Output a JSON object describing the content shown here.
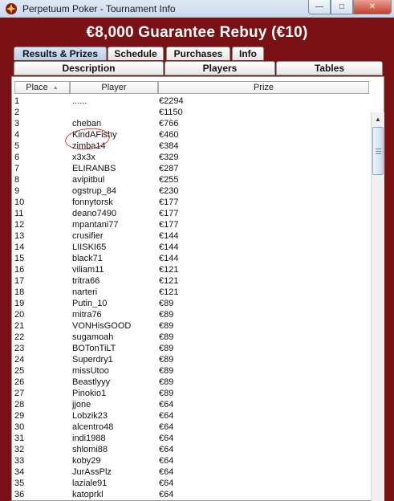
{
  "window": {
    "title": "Perpetuum Poker - Tournament Info",
    "minimize_glyph": "—",
    "maximize_glyph": "□",
    "close_glyph": "✕"
  },
  "heading": "€8,000 Guarantee Rebuy (€10)",
  "tabs_row1": {
    "results": "Results & Prizes",
    "schedule": "Schedule",
    "purchases": "Purchases",
    "info": "Info"
  },
  "tabs_row2": {
    "description": "Description",
    "players": "Players",
    "tables": "Tables"
  },
  "columns": {
    "place": "Place",
    "player": "Player",
    "prize": "Prize"
  },
  "rows": [
    {
      "place": "1",
      "player": "......",
      "prize": "€2294"
    },
    {
      "place": "2",
      "player": "",
      "prize": "€1150"
    },
    {
      "place": "3",
      "player": "cheban",
      "prize": "€766"
    },
    {
      "place": "4",
      "player": "KindAFishy",
      "prize": "€460"
    },
    {
      "place": "5",
      "player": "zimba14",
      "prize": "€384"
    },
    {
      "place": "6",
      "player": "x3x3x",
      "prize": "€329"
    },
    {
      "place": "7",
      "player": "ELIRANBS",
      "prize": "€287"
    },
    {
      "place": "8",
      "player": "avipitbul",
      "prize": "€255"
    },
    {
      "place": "9",
      "player": "ogstrup_84",
      "prize": "€230"
    },
    {
      "place": "10",
      "player": "fonnytorsk",
      "prize": "€177"
    },
    {
      "place": "11",
      "player": "deano7490",
      "prize": "€177"
    },
    {
      "place": "12",
      "player": "mpantani77",
      "prize": "€177"
    },
    {
      "place": "13",
      "player": "crusifier",
      "prize": "€144"
    },
    {
      "place": "14",
      "player": "LIISKI65",
      "prize": "€144"
    },
    {
      "place": "15",
      "player": "black71",
      "prize": "€144"
    },
    {
      "place": "16",
      "player": "viliam11",
      "prize": "€121"
    },
    {
      "place": "17",
      "player": "tritra66",
      "prize": "€121"
    },
    {
      "place": "18",
      "player": "narteri",
      "prize": "€121"
    },
    {
      "place": "19",
      "player": "Putin_10",
      "prize": "€89"
    },
    {
      "place": "20",
      "player": "mitra76",
      "prize": "€89"
    },
    {
      "place": "21",
      "player": "VONHisGOOD",
      "prize": "€89"
    },
    {
      "place": "22",
      "player": "sugamoah",
      "prize": "€89"
    },
    {
      "place": "23",
      "player": "BOTonTiLT",
      "prize": "€89"
    },
    {
      "place": "24",
      "player": "Superdry1",
      "prize": "€89"
    },
    {
      "place": "25",
      "player": "missUtoo",
      "prize": "€89"
    },
    {
      "place": "26",
      "player": "Beastlyyy",
      "prize": "€89"
    },
    {
      "place": "27",
      "player": "Pinokio1",
      "prize": "€89"
    },
    {
      "place": "28",
      "player": "jjone",
      "prize": "€64"
    },
    {
      "place": "29",
      "player": "Lobzik23",
      "prize": "€64"
    },
    {
      "place": "30",
      "player": "alcentro48",
      "prize": "€64"
    },
    {
      "place": "31",
      "player": "indi1988",
      "prize": "€64"
    },
    {
      "place": "32",
      "player": "shlomi88",
      "prize": "€64"
    },
    {
      "place": "33",
      "player": "koby29",
      "prize": "€64"
    },
    {
      "place": "34",
      "player": "JurAssPlz",
      "prize": "€64"
    },
    {
      "place": "35",
      "player": "laziale91",
      "prize": "€64"
    },
    {
      "place": "36",
      "player": "katoprkl",
      "prize": "€64"
    }
  ],
  "colors": {
    "frame": "#7a1215",
    "heading_text": "#ffffff",
    "highlight_ring": "#d2372f"
  }
}
